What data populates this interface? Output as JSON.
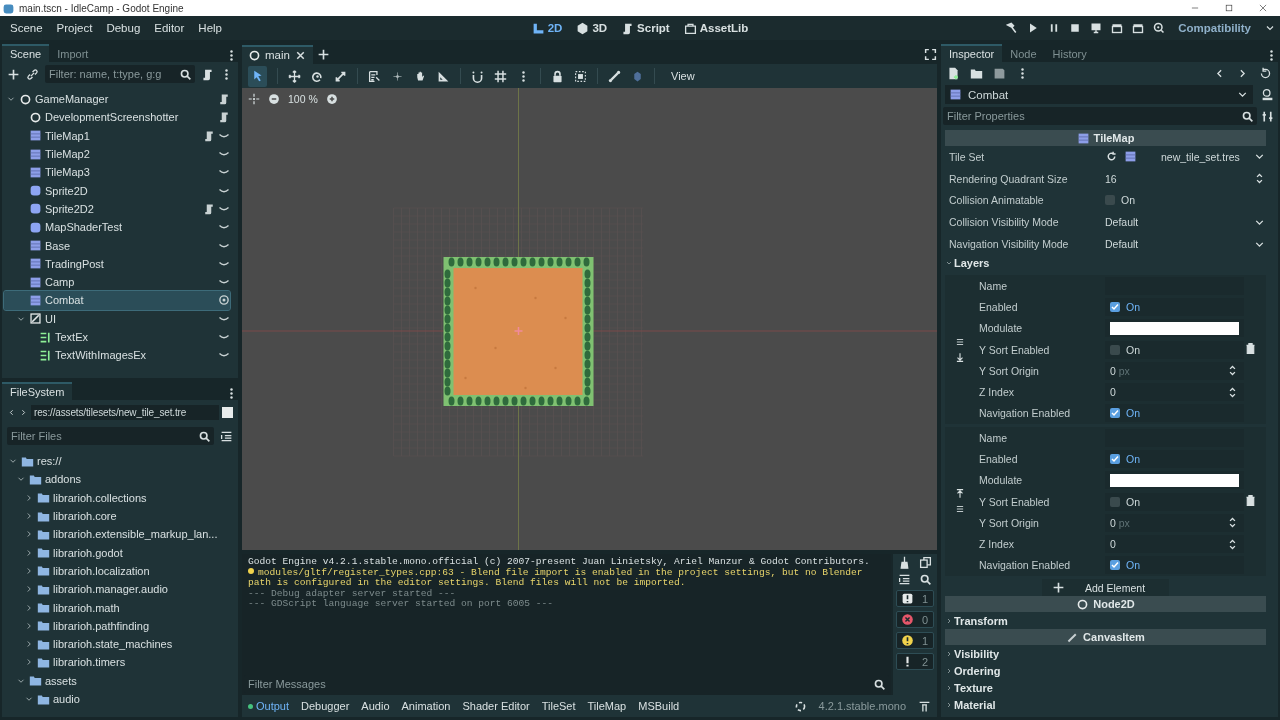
{
  "window": {
    "title": "main.tscn - IdleCamp - Godot Engine"
  },
  "menu": [
    "Scene",
    "Project",
    "Debug",
    "Editor",
    "Help"
  ],
  "workspaces": [
    {
      "label": "2D",
      "kind": "plane",
      "selected": true
    },
    {
      "label": "3D",
      "kind": "cube",
      "selected": false
    },
    {
      "label": "Script",
      "kind": "script",
      "selected": false
    },
    {
      "label": "AssetLib",
      "kind": "assetlib",
      "selected": false
    }
  ],
  "renderer": "Compatibility",
  "scene_dock": {
    "tabs": [
      {
        "label": "Scene",
        "selected": true
      },
      {
        "label": "Import",
        "selected": false
      }
    ],
    "filter": {
      "placeholder": "Filter: name, t:type, g:g"
    },
    "tree": [
      {
        "name": "GameManager",
        "kind": "node",
        "script": true,
        "eye": false,
        "selected": false,
        "expanded": true,
        "children": [
          {
            "name": "DevelopmentScreenshotter",
            "kind": "node",
            "script": true,
            "eye": false,
            "selected": false
          },
          {
            "name": "TileMap1",
            "kind": "tilemap",
            "script": true,
            "eye": true,
            "selected": false
          },
          {
            "name": "TileMap2",
            "kind": "tilemap",
            "script": false,
            "eye": true,
            "selected": false
          },
          {
            "name": "TileMap3",
            "kind": "tilemap",
            "script": false,
            "eye": true,
            "selected": false
          },
          {
            "name": "Sprite2D",
            "kind": "sprite",
            "script": false,
            "eye": true,
            "selected": false
          },
          {
            "name": "Sprite2D2",
            "kind": "sprite",
            "script": true,
            "eye": true,
            "selected": false
          },
          {
            "name": "MapShaderTest",
            "kind": "sprite",
            "script": false,
            "eye": true,
            "selected": false
          },
          {
            "name": "Base",
            "kind": "tilemap",
            "script": false,
            "eye": true,
            "selected": false
          },
          {
            "name": "TradingPost",
            "kind": "tilemap",
            "script": false,
            "eye": true,
            "selected": false
          },
          {
            "name": "Camp",
            "kind": "tilemap",
            "script": false,
            "eye": true,
            "selected": false
          },
          {
            "name": "Combat",
            "kind": "tilemap",
            "script": false,
            "eye": true,
            "selected": true
          },
          {
            "name": "UI",
            "kind": "control",
            "script": false,
            "eye": true,
            "selected": false,
            "expanded": true,
            "children": [
              {
                "name": "TextEx",
                "kind": "label",
                "script": false,
                "eye": true,
                "selected": false
              },
              {
                "name": "TextWithImagesEx",
                "kind": "label",
                "script": false,
                "eye": true,
                "selected": false
              }
            ]
          }
        ]
      }
    ]
  },
  "filesystem": {
    "title": "FileSystem",
    "path": "res://assets/tilesets/new_tile_set.tre",
    "filter": {
      "placeholder": "Filter Files"
    },
    "tree": [
      {
        "name": "res://",
        "expanded": true,
        "children": [
          {
            "name": "addons",
            "expanded": true,
            "children": [
              {
                "name": "librarioh.collections",
                "expanded": false
              },
              {
                "name": "librarioh.core",
                "expanded": false
              },
              {
                "name": "librarioh.extensible_markup_lan...",
                "expanded": false
              },
              {
                "name": "librarioh.godot",
                "expanded": false
              },
              {
                "name": "librarioh.localization",
                "expanded": false
              },
              {
                "name": "librarioh.manager.audio",
                "expanded": false
              },
              {
                "name": "librarioh.math",
                "expanded": false
              },
              {
                "name": "librarioh.pathfinding",
                "expanded": false
              },
              {
                "name": "librarioh.state_machines",
                "expanded": false
              },
              {
                "name": "librarioh.timers",
                "expanded": false
              }
            ]
          },
          {
            "name": "assets",
            "expanded": true,
            "children": [
              {
                "name": "audio",
                "expanded": true
              }
            ]
          }
        ]
      }
    ]
  },
  "editor": {
    "tabs": [
      {
        "label": "main",
        "selected": true
      }
    ],
    "view_menu": "View",
    "zoom": "100 %"
  },
  "output": {
    "lines": [
      {
        "kind": "info",
        "text": "Godot Engine v4.2.1.stable.mono.official (c) 2007-present Juan Linietsky, Ariel Manzur & Godot Contributors."
      },
      {
        "kind": "warning",
        "text": "modules/gltf/register_types.cpp:63 - Blend file import is enabled in the project settings, but no Blender path is configured in the editor settings. Blend files will not be imported."
      },
      {
        "kind": "muted",
        "text": "--- Debug adapter server started ---"
      },
      {
        "kind": "muted",
        "text": "--- GDScript language server started on port 6005 ---"
      }
    ],
    "filter": {
      "placeholder": "Filter Messages"
    },
    "counters": [
      {
        "kind": "message",
        "count": "1"
      },
      {
        "kind": "error",
        "count": "0"
      },
      {
        "kind": "warning",
        "count": "1"
      },
      {
        "kind": "editor",
        "count": "2"
      }
    ]
  },
  "bottom_panel": {
    "tabs": [
      {
        "label": "Output",
        "selected": true,
        "notify": true
      },
      {
        "label": "Debugger",
        "selected": false,
        "notify": false
      },
      {
        "label": "Audio",
        "selected": false,
        "notify": false
      },
      {
        "label": "Animation",
        "selected": false,
        "notify": false
      },
      {
        "label": "Shader Editor",
        "selected": false,
        "notify": false
      },
      {
        "label": "TileSet",
        "selected": false,
        "notify": false
      },
      {
        "label": "TileMap",
        "selected": false,
        "notify": false
      },
      {
        "label": "MSBuild",
        "selected": false,
        "notify": false
      }
    ],
    "version": "4.2.1.stable.mono"
  },
  "inspector": {
    "tabs": [
      {
        "label": "Inspector",
        "selected": true
      },
      {
        "label": "Node",
        "selected": false
      },
      {
        "label": "History",
        "selected": false
      }
    ],
    "object": "Combat",
    "filter": {
      "placeholder": "Filter Properties"
    },
    "items": [
      {
        "kind": "header",
        "label": "TileMap"
      },
      {
        "kind": "resource",
        "label": "Tile Set",
        "value": "new_tile_set.tres"
      },
      {
        "kind": "spin",
        "label": "Rendering Quadrant Size",
        "value": "16"
      },
      {
        "kind": "check",
        "label": "Collision Animatable",
        "checked": false,
        "value": "On"
      },
      {
        "kind": "dropdown",
        "label": "Collision Visibility Mode",
        "value": "Default"
      },
      {
        "kind": "dropdown",
        "label": "Navigation Visibility Mode",
        "value": "Default"
      },
      {
        "kind": "group",
        "label": "Layers",
        "expanded": true
      },
      {
        "kind": "layers",
        "add_label": "Add Element",
        "layers": [
          {
            "fields": [
              {
                "label": "Name",
                "kind": "text"
              },
              {
                "label": "Enabled",
                "kind": "check",
                "checked": true,
                "value": "On"
              },
              {
                "label": "Modulate",
                "kind": "color"
              },
              {
                "label": "Y Sort Enabled",
                "kind": "check",
                "checked": false,
                "value": "On"
              },
              {
                "label": "Y Sort Origin",
                "kind": "spin",
                "value": "0",
                "unit": "px"
              },
              {
                "label": "Z Index",
                "kind": "spin",
                "value": "0"
              },
              {
                "label": "Navigation Enabled",
                "kind": "check",
                "checked": true,
                "value": "On"
              }
            ]
          },
          {
            "fields": [
              {
                "label": "Name",
                "kind": "text"
              },
              {
                "label": "Enabled",
                "kind": "check",
                "checked": true,
                "value": "On"
              },
              {
                "label": "Modulate",
                "kind": "color"
              },
              {
                "label": "Y Sort Enabled",
                "kind": "check",
                "checked": false,
                "value": "On"
              },
              {
                "label": "Y Sort Origin",
                "kind": "spin",
                "value": "0",
                "unit": "px"
              },
              {
                "label": "Z Index",
                "kind": "spin",
                "value": "0"
              },
              {
                "label": "Navigation Enabled",
                "kind": "check",
                "checked": true,
                "value": "On"
              }
            ]
          }
        ]
      },
      {
        "kind": "header",
        "label": "Node2D"
      },
      {
        "kind": "group",
        "label": "Transform",
        "expanded": false
      },
      {
        "kind": "header",
        "label": "CanvasItem"
      },
      {
        "kind": "group",
        "label": "Visibility",
        "expanded": false
      },
      {
        "kind": "group",
        "label": "Ordering",
        "expanded": false
      },
      {
        "kind": "group",
        "label": "Texture",
        "expanded": false
      },
      {
        "kind": "group",
        "label": "Material",
        "expanded": false
      }
    ]
  }
}
